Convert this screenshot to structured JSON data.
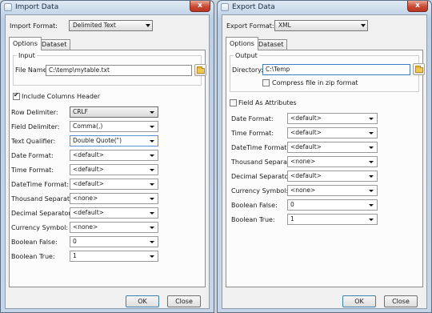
{
  "import": {
    "title": "Import Data",
    "close_glyph": "x",
    "format_label": "Import Format:",
    "format_value": "Delimited Text",
    "tabs": [
      "Options",
      "Dataset"
    ],
    "input_group": "Input",
    "file_name_label": "File Name:",
    "file_name_value": "C:\\temp\\mytable.txt",
    "include_header_label": "Include Columns Header",
    "include_header_checked": true,
    "fields": [
      {
        "label": "Row Delimiter:",
        "value": "CRLF"
      },
      {
        "label": "Field Delimiter:",
        "value": "Comma(,)"
      },
      {
        "label": "Text Qualifier:",
        "value": "Double Quote(\")"
      },
      {
        "label": "Date Format:",
        "value": "<default>"
      },
      {
        "label": "Time Format:",
        "value": "<default>"
      },
      {
        "label": "DateTime Format:",
        "value": "<default>"
      },
      {
        "label": "Thousand Separator:",
        "value": "<none>"
      },
      {
        "label": "Decimal Separator:",
        "value": "<default>"
      },
      {
        "label": "Currency Symbol:",
        "value": "<none>"
      },
      {
        "label": "Boolean False:",
        "value": "0"
      },
      {
        "label": "Boolean True:",
        "value": "1"
      }
    ],
    "ok_label": "OK",
    "close_label": "Close"
  },
  "export": {
    "title": "Export Data",
    "close_glyph": "x",
    "format_label": "Export Format:",
    "format_value": "XML",
    "tabs": [
      "Options",
      "Dataset"
    ],
    "output_group": "Output",
    "directory_label": "Directory:",
    "directory_value": "C:\\Temp",
    "compress_label": "Compress file in zip format",
    "compress_checked": false,
    "field_attr_label": "Field As Attributes",
    "field_attr_checked": false,
    "fields": [
      {
        "label": "Date Format:",
        "value": "<default>"
      },
      {
        "label": "Time Format:",
        "value": "<default>"
      },
      {
        "label": "DateTime Format:",
        "value": "<default>"
      },
      {
        "label": "Thousand Separator:",
        "value": "<none>"
      },
      {
        "label": "Decimal Separator:",
        "value": "<default>"
      },
      {
        "label": "Currency Symbol:",
        "value": "<none>"
      },
      {
        "label": "Boolean False:",
        "value": "0"
      },
      {
        "label": "Boolean True:",
        "value": "1"
      }
    ],
    "ok_label": "OK",
    "close_label": "Close"
  }
}
